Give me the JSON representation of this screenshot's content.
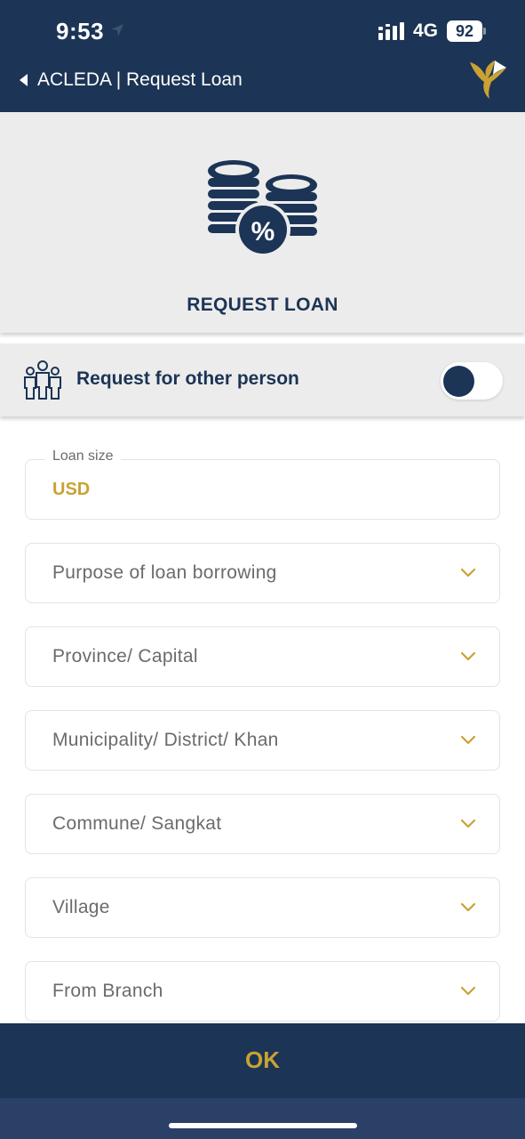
{
  "status_bar": {
    "time": "9:53",
    "network": "4G",
    "battery": "92"
  },
  "nav": {
    "title": "ACLEDA | Request Loan"
  },
  "hero": {
    "title": "REQUEST LOAN",
    "icon": "coins-percent-icon"
  },
  "other_person": {
    "label": "Request for other person",
    "enabled": false
  },
  "form": {
    "loan_size": {
      "label": "Loan size",
      "value": "USD"
    },
    "fields": [
      {
        "label": "Purpose of loan borrowing"
      },
      {
        "label": "Province/ Capital"
      },
      {
        "label": "Municipality/ District/ Khan"
      },
      {
        "label": "Commune/ Sangkat"
      },
      {
        "label": "Village"
      },
      {
        "label": "From Branch"
      }
    ]
  },
  "footer": {
    "ok_label": "OK"
  },
  "colors": {
    "navy": "#1c3455",
    "gold": "#c9a233",
    "panel": "#ececec"
  }
}
